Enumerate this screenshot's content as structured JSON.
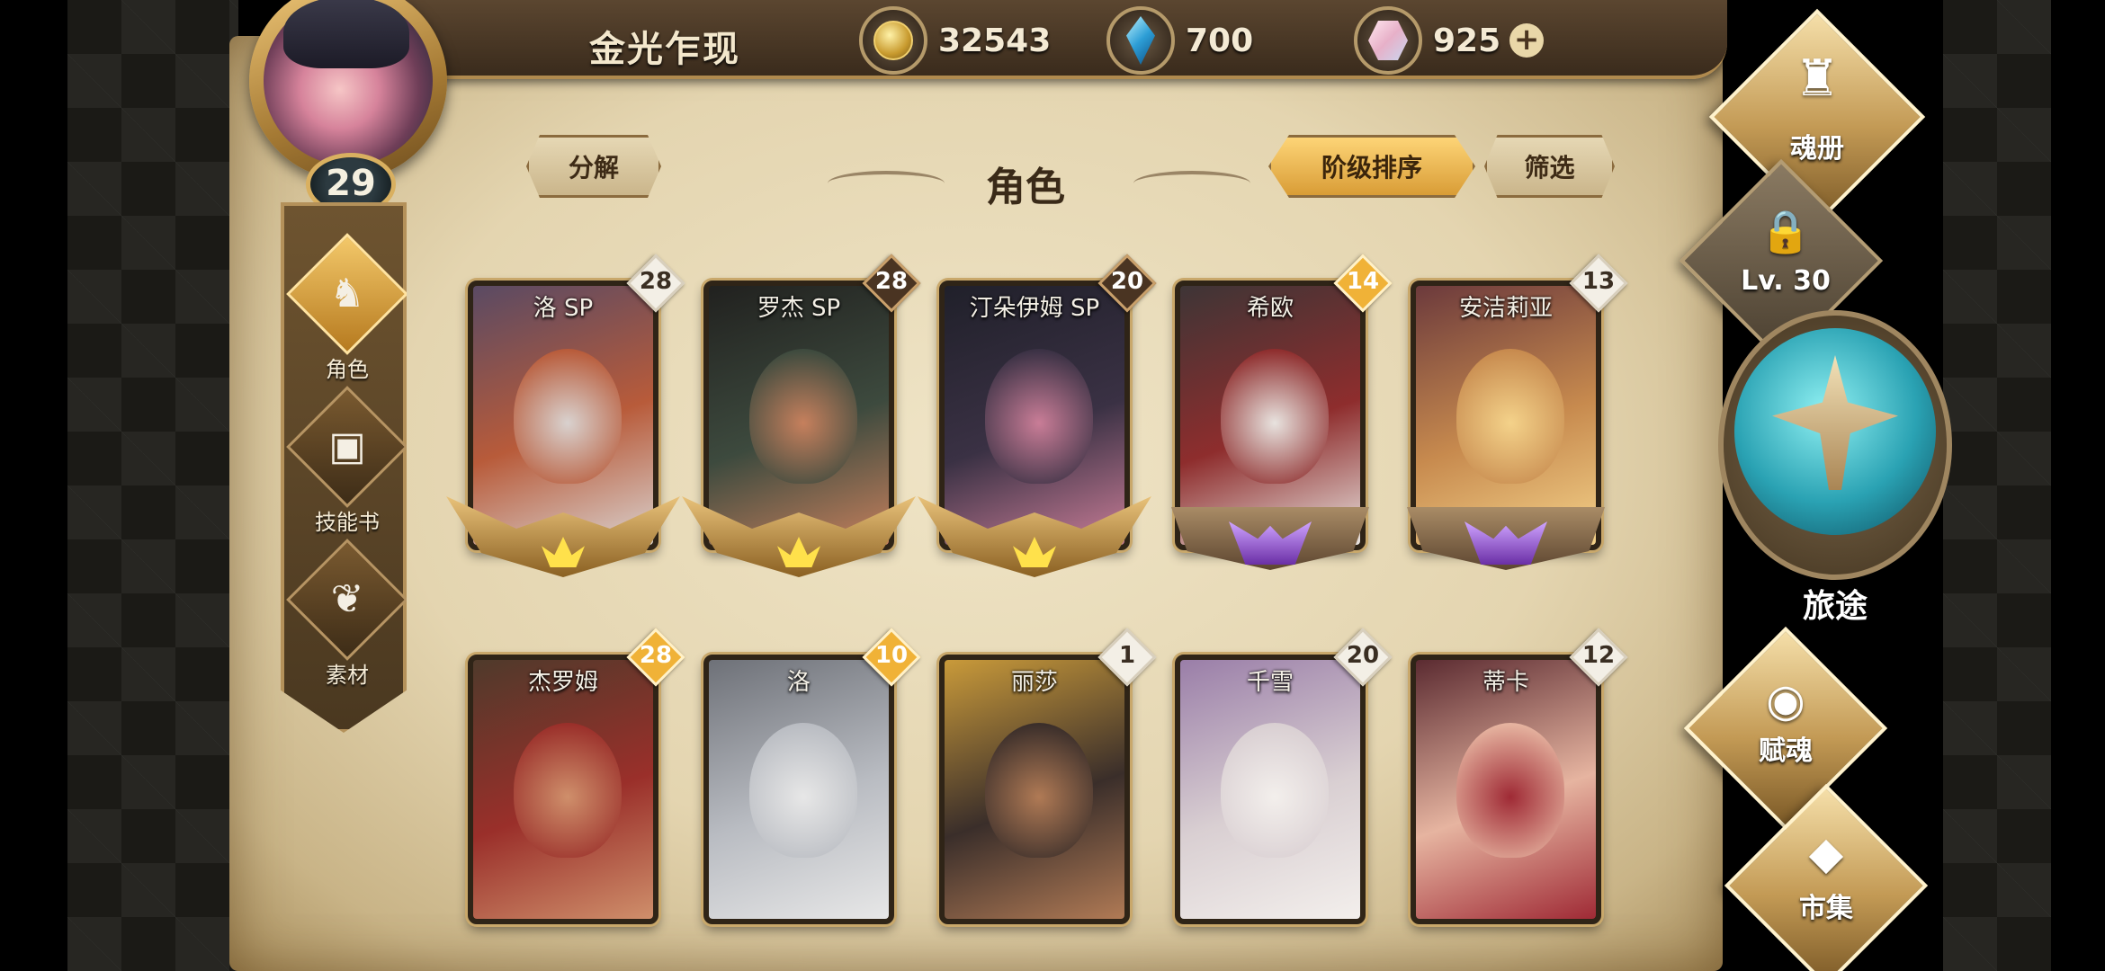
{
  "topbar": {
    "player_name": "金光乍现",
    "gold": "32543",
    "crystals": "700",
    "gems": "925",
    "plus": "+"
  },
  "avatar": {
    "level": "29"
  },
  "left_nav": [
    {
      "label": "角色",
      "icon": "character-icon",
      "active": true
    },
    {
      "label": "技能书",
      "icon": "skill-book-icon",
      "active": false
    },
    {
      "label": "素材",
      "icon": "material-icon",
      "active": false
    }
  ],
  "toolbar": {
    "decompose_label": "分解",
    "title": "角色",
    "sort_label": "阶级排序",
    "filter_label": "筛选"
  },
  "cards": [
    {
      "name": "洛 SP",
      "level": "28",
      "badge": "white",
      "rank": "gold"
    },
    {
      "name": "罗杰 SP",
      "level": "28",
      "badge": "dark",
      "rank": "gold"
    },
    {
      "name": "汀朵伊姆 SP",
      "level": "20",
      "badge": "dark",
      "rank": "gold"
    },
    {
      "name": "希欧",
      "level": "14",
      "badge": "orange",
      "rank": "purple"
    },
    {
      "name": "安洁莉亚",
      "level": "13",
      "badge": "white",
      "rank": "purple"
    },
    {
      "name": "杰罗姆",
      "level": "28",
      "badge": "orange",
      "rank": "none"
    },
    {
      "name": "洛",
      "level": "10",
      "badge": "orange",
      "rank": "none"
    },
    {
      "name": "丽莎",
      "level": "1",
      "badge": "white",
      "rank": "none"
    },
    {
      "name": "千雪",
      "level": "20",
      "badge": "white",
      "rank": "none"
    },
    {
      "name": "蒂卡",
      "level": "12",
      "badge": "white",
      "rank": "none"
    }
  ],
  "right_menu": {
    "soul_book": "魂册",
    "locked_label": "Lv. 30",
    "journey": "旅途",
    "soul_bestow": "赋魂",
    "market": "市集"
  },
  "colors": {
    "gold_accent": "#d79a33",
    "parchment": "#e4d5b0",
    "dark_wood": "#3a2b1c"
  }
}
